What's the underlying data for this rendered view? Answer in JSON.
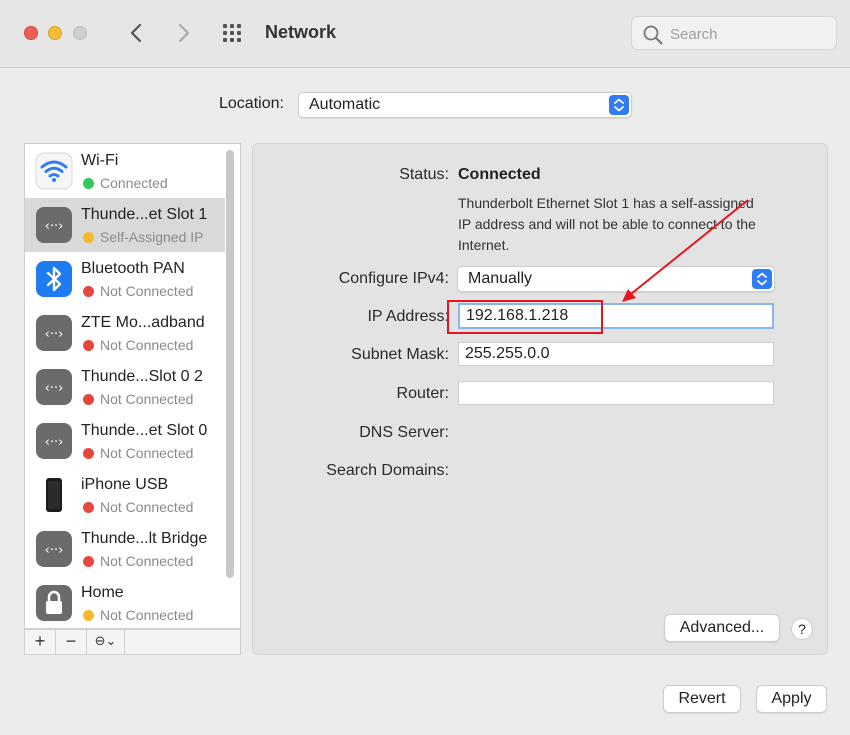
{
  "window": {
    "title": "Network",
    "search_placeholder": "Search"
  },
  "location": {
    "label": "Location:",
    "value": "Automatic"
  },
  "services": [
    {
      "name": "Wi-Fi",
      "status": "Connected",
      "dot_color": "#34c759",
      "icon": "wifi-icon"
    },
    {
      "name": "Thunde...et Slot 1",
      "status": "Self-Assigned IP",
      "dot_color": "#f5b82e",
      "icon": "ethernet-icon"
    },
    {
      "name": "Bluetooth PAN",
      "status": "Not Connected",
      "dot_color": "#e5463e",
      "icon": "bluetooth-icon"
    },
    {
      "name": "ZTE Mo...adband",
      "status": "Not Connected",
      "dot_color": "#e5463e",
      "icon": "ethernet-icon"
    },
    {
      "name": "Thunde...Slot 0 2",
      "status": "Not Connected",
      "dot_color": "#e5463e",
      "icon": "ethernet-icon"
    },
    {
      "name": "Thunde...et Slot 0",
      "status": "Not Connected",
      "dot_color": "#e5463e",
      "icon": "ethernet-icon"
    },
    {
      "name": "iPhone USB",
      "status": "Not Connected",
      "dot_color": "#e5463e",
      "icon": "iphone-icon"
    },
    {
      "name": "Thunde...lt Bridge",
      "status": "Not Connected",
      "dot_color": "#e5463e",
      "icon": "ethernet-icon"
    },
    {
      "name": "Home",
      "status": "Not Connected",
      "dot_color": "#f5b82e",
      "icon": "lock-icon"
    }
  ],
  "sidebar_toolbar": {
    "add": "+",
    "remove": "−",
    "action": "⊖⌄"
  },
  "detail": {
    "status_label": "Status:",
    "status_value": "Connected",
    "status_description": "Thunderbolt Ethernet Slot 1 has a self-assigned IP address and will not be able to connect to the Internet.",
    "configure_label": "Configure IPv4:",
    "configure_value": "Manually",
    "ip_label": "IP Address:",
    "ip_value": "192.168.1.218",
    "subnet_label": "Subnet Mask:",
    "subnet_value": "255.255.0.0",
    "router_label": "Router:",
    "router_value": "",
    "dns_label": "DNS Server:",
    "search_domains_label": "Search Domains:"
  },
  "buttons": {
    "advanced": "Advanced...",
    "help": "?",
    "revert": "Revert",
    "apply": "Apply"
  },
  "colors": {
    "accent": "#2f7cf6",
    "annotation": "#e2161c"
  }
}
